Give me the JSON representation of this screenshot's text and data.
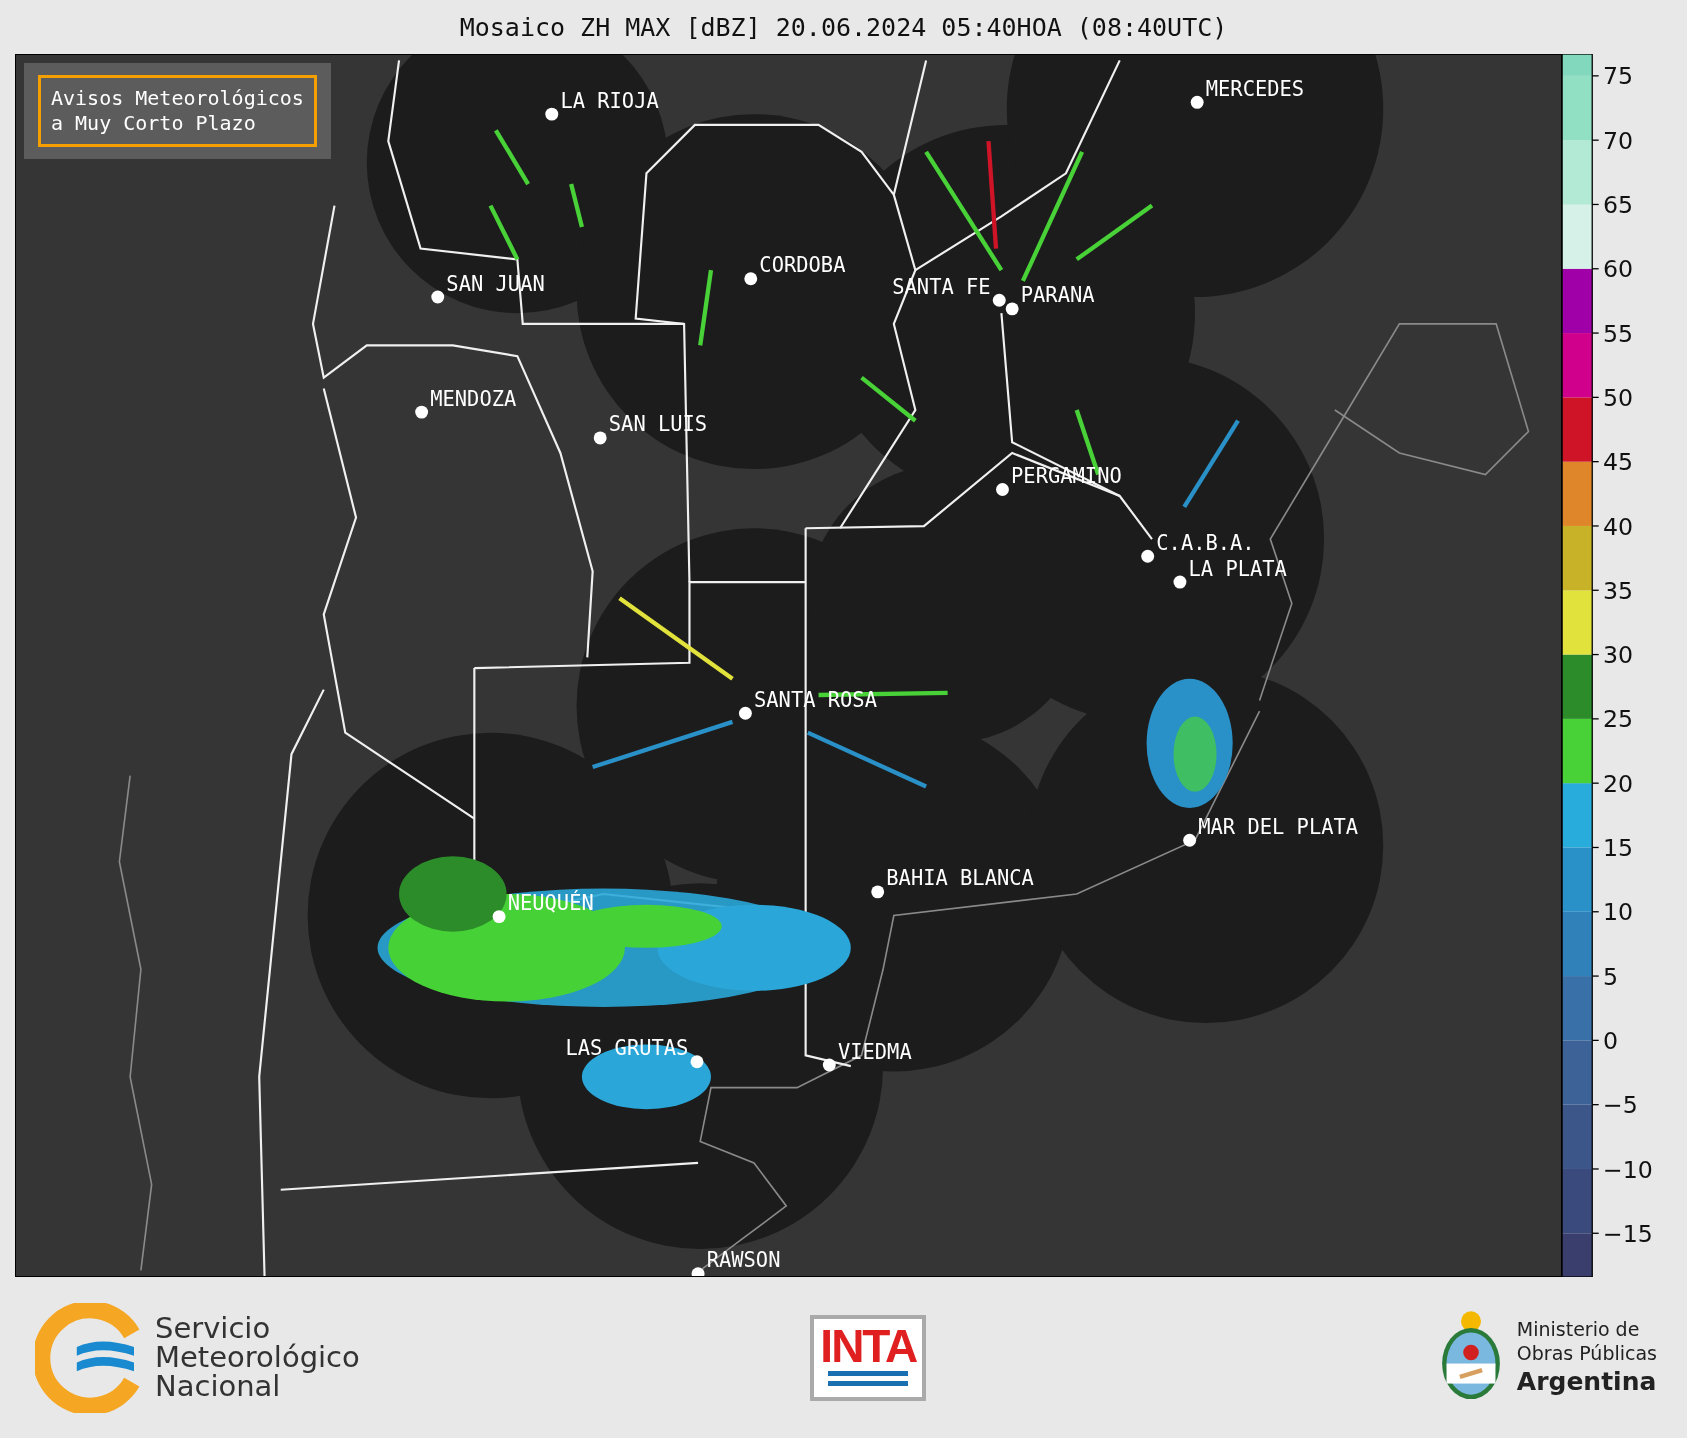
{
  "title": "Mosaico ZH MAX [dBZ] 20.06.2024 05:40HOA (08:40UTC)",
  "warning_box": {
    "lines": [
      "Avisos Meteorológicos",
      "a Muy Corto Plazo"
    ]
  },
  "cities": [
    {
      "name": "LA RIOJA"
    },
    {
      "name": "SAN JUAN"
    },
    {
      "name": "CORDOBA"
    },
    {
      "name": "SANTA FE"
    },
    {
      "name": "PARANA"
    },
    {
      "name": "MERCEDES"
    },
    {
      "name": "MENDOZA"
    },
    {
      "name": "SAN LUIS"
    },
    {
      "name": "PERGAMINO"
    },
    {
      "name": "C.A.B.A."
    },
    {
      "name": "LA PLATA"
    },
    {
      "name": "SANTA ROSA"
    },
    {
      "name": "MAR DEL PLATA"
    },
    {
      "name": "BAHIA BLANCA"
    },
    {
      "name": "NEUQUÉN"
    },
    {
      "name": "LAS GRUTAS"
    },
    {
      "name": "VIEDMA"
    },
    {
      "name": "RAWSON"
    }
  ],
  "colorbar": {
    "ticks": [
      "75",
      "70",
      "65",
      "60",
      "55",
      "50",
      "45",
      "40",
      "35",
      "30",
      "25",
      "20",
      "15",
      "10",
      "5",
      "0",
      "−5",
      "−10",
      "−15"
    ],
    "bands": [
      {
        "color": "#3a3e6c"
      },
      {
        "color": "#3b4a7c"
      },
      {
        "color": "#3c568a"
      },
      {
        "color": "#3d6298"
      },
      {
        "color": "#3a70a8"
      },
      {
        "color": "#3080ba"
      },
      {
        "color": "#2a90c8"
      },
      {
        "color": "#28acdc"
      },
      {
        "color": "#48d238"
      },
      {
        "color": "#2c8c2a"
      },
      {
        "color": "#e2e23c"
      },
      {
        "color": "#c8b228"
      },
      {
        "color": "#e0862a"
      },
      {
        "color": "#d01428"
      },
      {
        "color": "#d0008c"
      },
      {
        "color": "#a000a8"
      },
      {
        "color": "#d6f2e8"
      },
      {
        "color": "#b2ead6"
      },
      {
        "color": "#92e0c4"
      },
      {
        "color": "#82d8bc"
      }
    ]
  },
  "footer": {
    "smn": [
      "Servicio",
      "Meteorológico",
      "Nacional"
    ],
    "inta": "INTA",
    "ministry": [
      "Ministerio de",
      "Obras Públicas",
      "Argentina"
    ]
  }
}
